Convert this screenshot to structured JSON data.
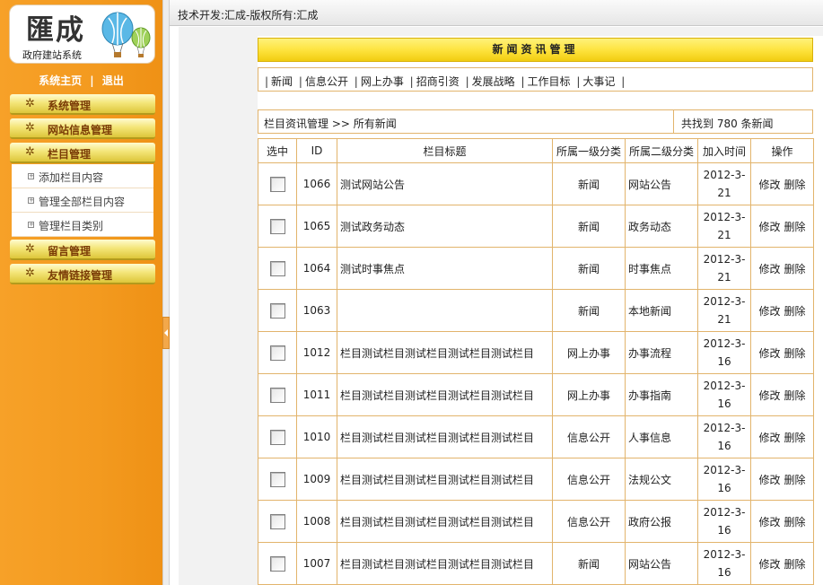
{
  "logo": {
    "title": "匯成",
    "subtitle": "政府建站系统"
  },
  "top_links": {
    "home": "系统主页",
    "separator": "|",
    "logout": "退出"
  },
  "sidebar": {
    "menus": [
      {
        "label": "系统管理"
      },
      {
        "label": "网站信息管理"
      },
      {
        "label": "栏目管理"
      },
      {
        "label": "留言管理"
      },
      {
        "label": "友情链接管理"
      }
    ],
    "sub_items": [
      {
        "label": "添加栏目内容"
      },
      {
        "label": "管理全部栏目内容"
      },
      {
        "label": "管理栏目类别"
      }
    ]
  },
  "topbar": {
    "text": "技术开发:汇成-版权所有:汇成"
  },
  "panel": {
    "title": "新闻资讯管理"
  },
  "categories": [
    "新闻",
    "信息公开",
    "网上办事",
    "招商引资",
    "发展战略",
    "工作目标",
    "大事记"
  ],
  "info": {
    "breadcrumb": "栏目资讯管理 >> 所有新闻",
    "count_text": "共找到 780 条新闻"
  },
  "table": {
    "headers": [
      "选中",
      "ID",
      "栏目标题",
      "所属一级分类",
      "所属二级分类",
      "加入时间",
      "操作"
    ],
    "edit_label": "修改",
    "delete_label": "删除",
    "rows": [
      {
        "id": "1066",
        "title": "测试网站公告",
        "cat1": "新闻",
        "cat2": "网站公告",
        "time": "2012-3-21"
      },
      {
        "id": "1065",
        "title": "测试政务动态",
        "cat1": "新闻",
        "cat2": "政务动态",
        "time": "2012-3-21"
      },
      {
        "id": "1064",
        "title": "测试时事焦点",
        "cat1": "新闻",
        "cat2": "时事焦点",
        "time": "2012-3-21"
      },
      {
        "id": "1063",
        "title": "",
        "cat1": "新闻",
        "cat2": "本地新闻",
        "time": "2012-3-21"
      },
      {
        "id": "1012",
        "title": "栏目测试栏目测试栏目测试栏目测试栏目",
        "cat1": "网上办事",
        "cat2": "办事流程",
        "time": "2012-3-16"
      },
      {
        "id": "1011",
        "title": "栏目测试栏目测试栏目测试栏目测试栏目",
        "cat1": "网上办事",
        "cat2": "办事指南",
        "time": "2012-3-16"
      },
      {
        "id": "1010",
        "title": "栏目测试栏目测试栏目测试栏目测试栏目",
        "cat1": "信息公开",
        "cat2": "人事信息",
        "time": "2012-3-16"
      },
      {
        "id": "1009",
        "title": "栏目测试栏目测试栏目测试栏目测试栏目",
        "cat1": "信息公开",
        "cat2": "法规公文",
        "time": "2012-3-16"
      },
      {
        "id": "1008",
        "title": "栏目测试栏目测试栏目测试栏目测试栏目",
        "cat1": "信息公开",
        "cat2": "政府公报",
        "time": "2012-3-16"
      },
      {
        "id": "1007",
        "title": "栏目测试栏目测试栏目测试栏目测试栏目",
        "cat1": "新闻",
        "cat2": "网站公告",
        "time": "2012-3-16"
      }
    ]
  }
}
